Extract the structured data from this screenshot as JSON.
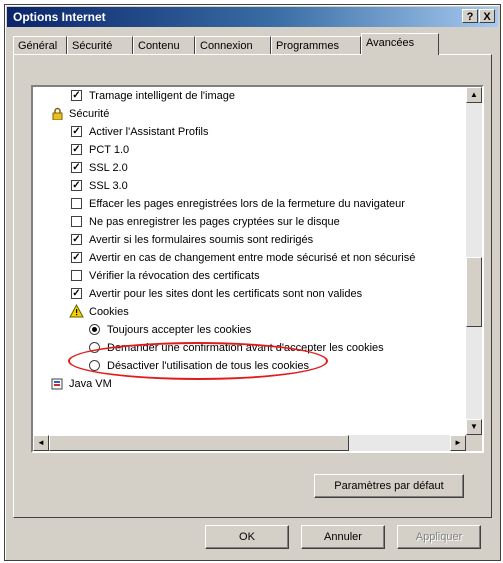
{
  "window": {
    "title": "Options Internet",
    "help_button": "?",
    "close_button": "X"
  },
  "tabs": [
    {
      "label": "Général"
    },
    {
      "label": "Sécurité"
    },
    {
      "label": "Contenu"
    },
    {
      "label": "Connexion"
    },
    {
      "label": "Programmes"
    },
    {
      "label": "Avancées"
    }
  ],
  "settings": [
    {
      "type": "checkbox",
      "checked": true,
      "label": "Tramage intelligent de l'image"
    },
    {
      "type": "section",
      "icon": "lock-icon",
      "label": "Sécurité"
    },
    {
      "type": "checkbox",
      "checked": true,
      "label": "Activer l'Assistant Profils"
    },
    {
      "type": "checkbox",
      "checked": true,
      "label": "PCT 1.0"
    },
    {
      "type": "checkbox",
      "checked": true,
      "label": "SSL 2.0"
    },
    {
      "type": "checkbox",
      "checked": true,
      "label": "SSL 3.0"
    },
    {
      "type": "checkbox",
      "checked": false,
      "label": "Effacer les pages enregistrées lors de la fermeture du navigateur"
    },
    {
      "type": "checkbox",
      "checked": false,
      "label": "Ne pas enregistrer les pages cryptées sur le disque"
    },
    {
      "type": "checkbox",
      "checked": true,
      "label": "Avertir si les formulaires soumis sont redirigés"
    },
    {
      "type": "checkbox",
      "checked": true,
      "label": "Avertir en cas de changement entre mode sécurisé et non sécurisé"
    },
    {
      "type": "checkbox",
      "checked": false,
      "label": "Vérifier la révocation des certificats"
    },
    {
      "type": "checkbox",
      "checked": true,
      "label": "Avertir pour les sites dont les certificats sont non valides"
    },
    {
      "type": "section",
      "icon": "warning-icon",
      "label": "Cookies"
    },
    {
      "type": "radio",
      "checked": true,
      "label": "Toujours accepter les cookies"
    },
    {
      "type": "radio",
      "checked": false,
      "label": "Demander une confirmation avant d'accepter les cookies"
    },
    {
      "type": "radio",
      "checked": false,
      "label": "Désactiver l'utilisation de tous les cookies"
    },
    {
      "type": "section",
      "icon": "java-icon",
      "label": "Java VM"
    }
  ],
  "buttons": {
    "defaults": "Paramètres par défaut",
    "ok": "OK",
    "cancel": "Annuler",
    "apply": "Appliquer"
  },
  "colors": {
    "highlight": "#e21c1c",
    "title_bar": "#0a246a"
  }
}
